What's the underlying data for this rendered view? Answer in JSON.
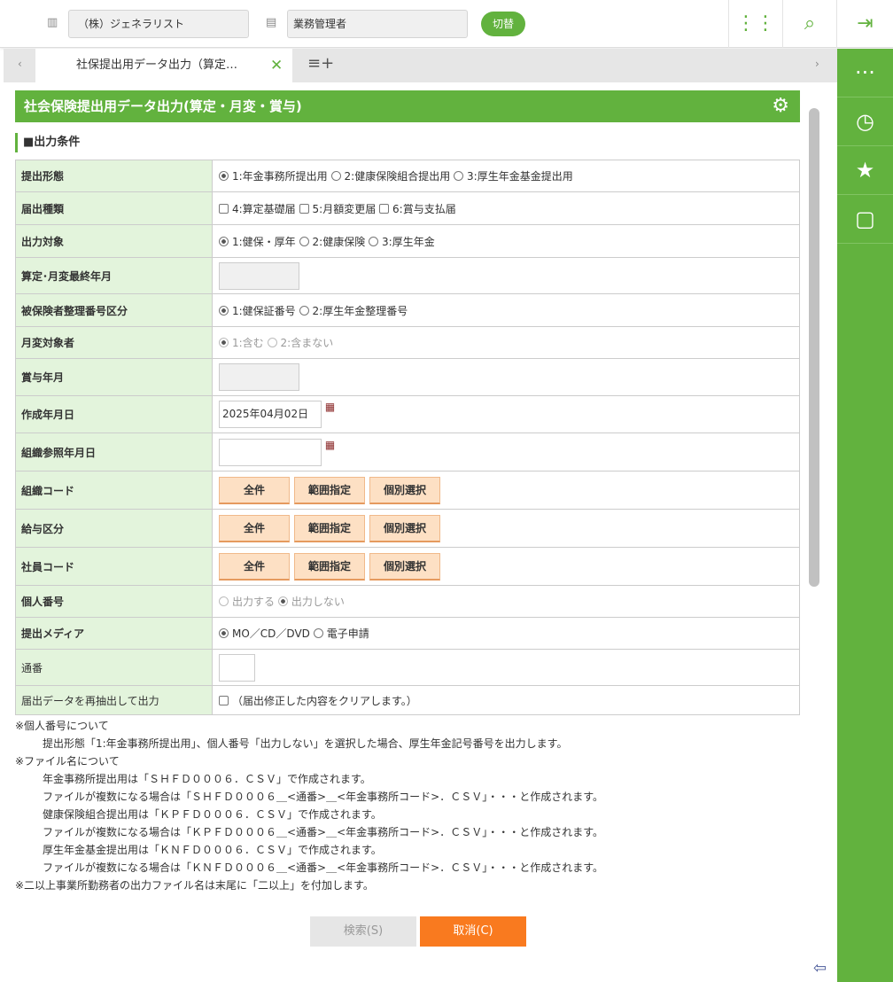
{
  "header": {
    "company": "（株）ジェネラリスト",
    "role": "業務管理者",
    "switch_label": "切替"
  },
  "tab": {
    "label": "社保提出用データ出力（算定…"
  },
  "page": {
    "title": "社会保険提出用データ出力(算定・月変・賞与)",
    "section": "■出力条件"
  },
  "rows": {
    "r0": {
      "label": "提出形態",
      "o1": "1:年金事務所提出用",
      "o2": "2:健康保険組合提出用",
      "o3": "3:厚生年金基金提出用"
    },
    "r1": {
      "label": "届出種類",
      "o1": "4:算定基礎届",
      "o2": "5:月額変更届",
      "o3": "6:賞与支払届"
    },
    "r2": {
      "label": "出力対象",
      "o1": "1:健保・厚年",
      "o2": "2:健康保険",
      "o3": "3:厚生年金"
    },
    "r3": {
      "label": "算定･月変最終年月"
    },
    "r4": {
      "label": "被保険者整理番号区分",
      "o1": "1:健保証番号",
      "o2": "2:厚生年金整理番号"
    },
    "r5": {
      "label": "月変対象者",
      "o1": "1:含む",
      "o2": "2:含まない"
    },
    "r6": {
      "label": "賞与年月"
    },
    "r7": {
      "label": "作成年月日",
      "value": "2025年04月02日"
    },
    "r8": {
      "label": "組織参照年月日",
      "value": ""
    },
    "r9": {
      "label": "組織コード"
    },
    "r10": {
      "label": "給与区分"
    },
    "r11": {
      "label": "社員コード"
    },
    "r12": {
      "label": "個人番号",
      "o1": "出力する",
      "o2": "出力しない"
    },
    "r13": {
      "label": "提出メディア",
      "o1": "MO／CD／DVD",
      "o2": "電子申請"
    },
    "r14": {
      "label": "通番",
      "value": ""
    },
    "r15": {
      "label": "届出データを再抽出して出力",
      "o1": "（届出修正した内容をクリアします。）"
    }
  },
  "select_buttons": {
    "all": "全件",
    "range": "範囲指定",
    "individual": "個別選択"
  },
  "notes": [
    "※個人番号について",
    "提出形態「1:年金事務所提出用」、個人番号「出力しない」を選択した場合、厚生年金記号番号を出力します。",
    "※ファイル名について",
    "年金事務所提出用は「ＳＨＦＤ０００６．ＣＳＶ」で作成されます。",
    "ファイルが複数になる場合は「ＳＨＦＤ０００６＿<通番>＿<年金事務所コード>．ＣＳＶ」・・・と作成されます。",
    "健康保険組合提出用は「ＫＰＦＤ０００６．ＣＳＶ」で作成されます。",
    "ファイルが複数になる場合は「ＫＰＦＤ０００６＿<通番>＿<年金事務所コード>．ＣＳＶ」・・・と作成されます。",
    "厚生年金基金提出用は「ＫＮＦＤ０００６．ＣＳＶ」で作成されます。",
    "ファイルが複数になる場合は「ＫＮＦＤ０００６＿<通番>＿<年金事務所コード>．ＣＳＶ」・・・と作成されます。",
    "※二以上事業所勤務者の出力ファイル名は末尾に「二以上」を付加します。"
  ],
  "footer": {
    "search": "検索(S)",
    "cancel": "取消(C)"
  },
  "colors": {
    "brand": "#62b23e",
    "cancel": "#f97a1f",
    "label_bg": "#e3f4dc"
  }
}
